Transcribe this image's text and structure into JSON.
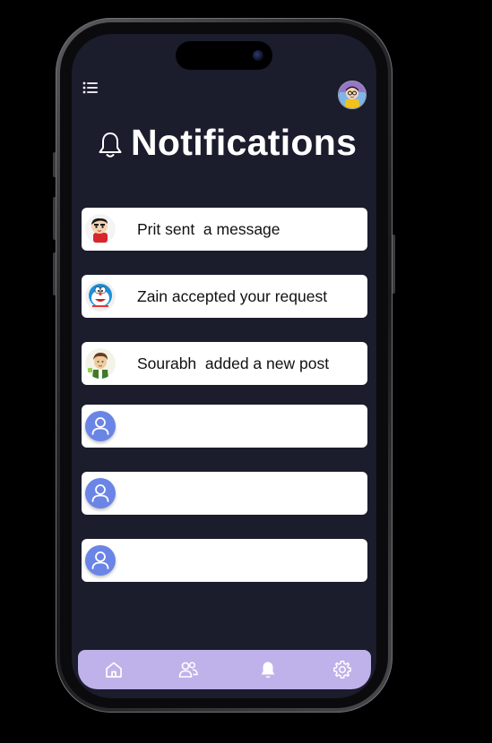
{
  "screen": {
    "title": "Notifications"
  },
  "notifications": [
    {
      "text": "Prit sent  a message",
      "avatar": "shinchan-avatar"
    },
    {
      "text": "Zain accepted your request",
      "avatar": "doraemon-avatar"
    },
    {
      "text": "Sourabh  added a new post",
      "avatar": "ben10-avatar"
    },
    {
      "text": "",
      "avatar": "user-placeholder-icon"
    },
    {
      "text": "",
      "avatar": "user-placeholder-icon"
    },
    {
      "text": "",
      "avatar": "user-placeholder-icon"
    }
  ],
  "bottom_nav": {
    "items": [
      "home-icon",
      "users-icon",
      "bell-icon",
      "gear-icon"
    ],
    "active": "bell-icon"
  },
  "colors": {
    "background": "#000000",
    "screen": "#1b1c2c",
    "card": "#ffffff",
    "nav": "#bfb2ea",
    "placeholder_avatar": "#6b85e6"
  }
}
